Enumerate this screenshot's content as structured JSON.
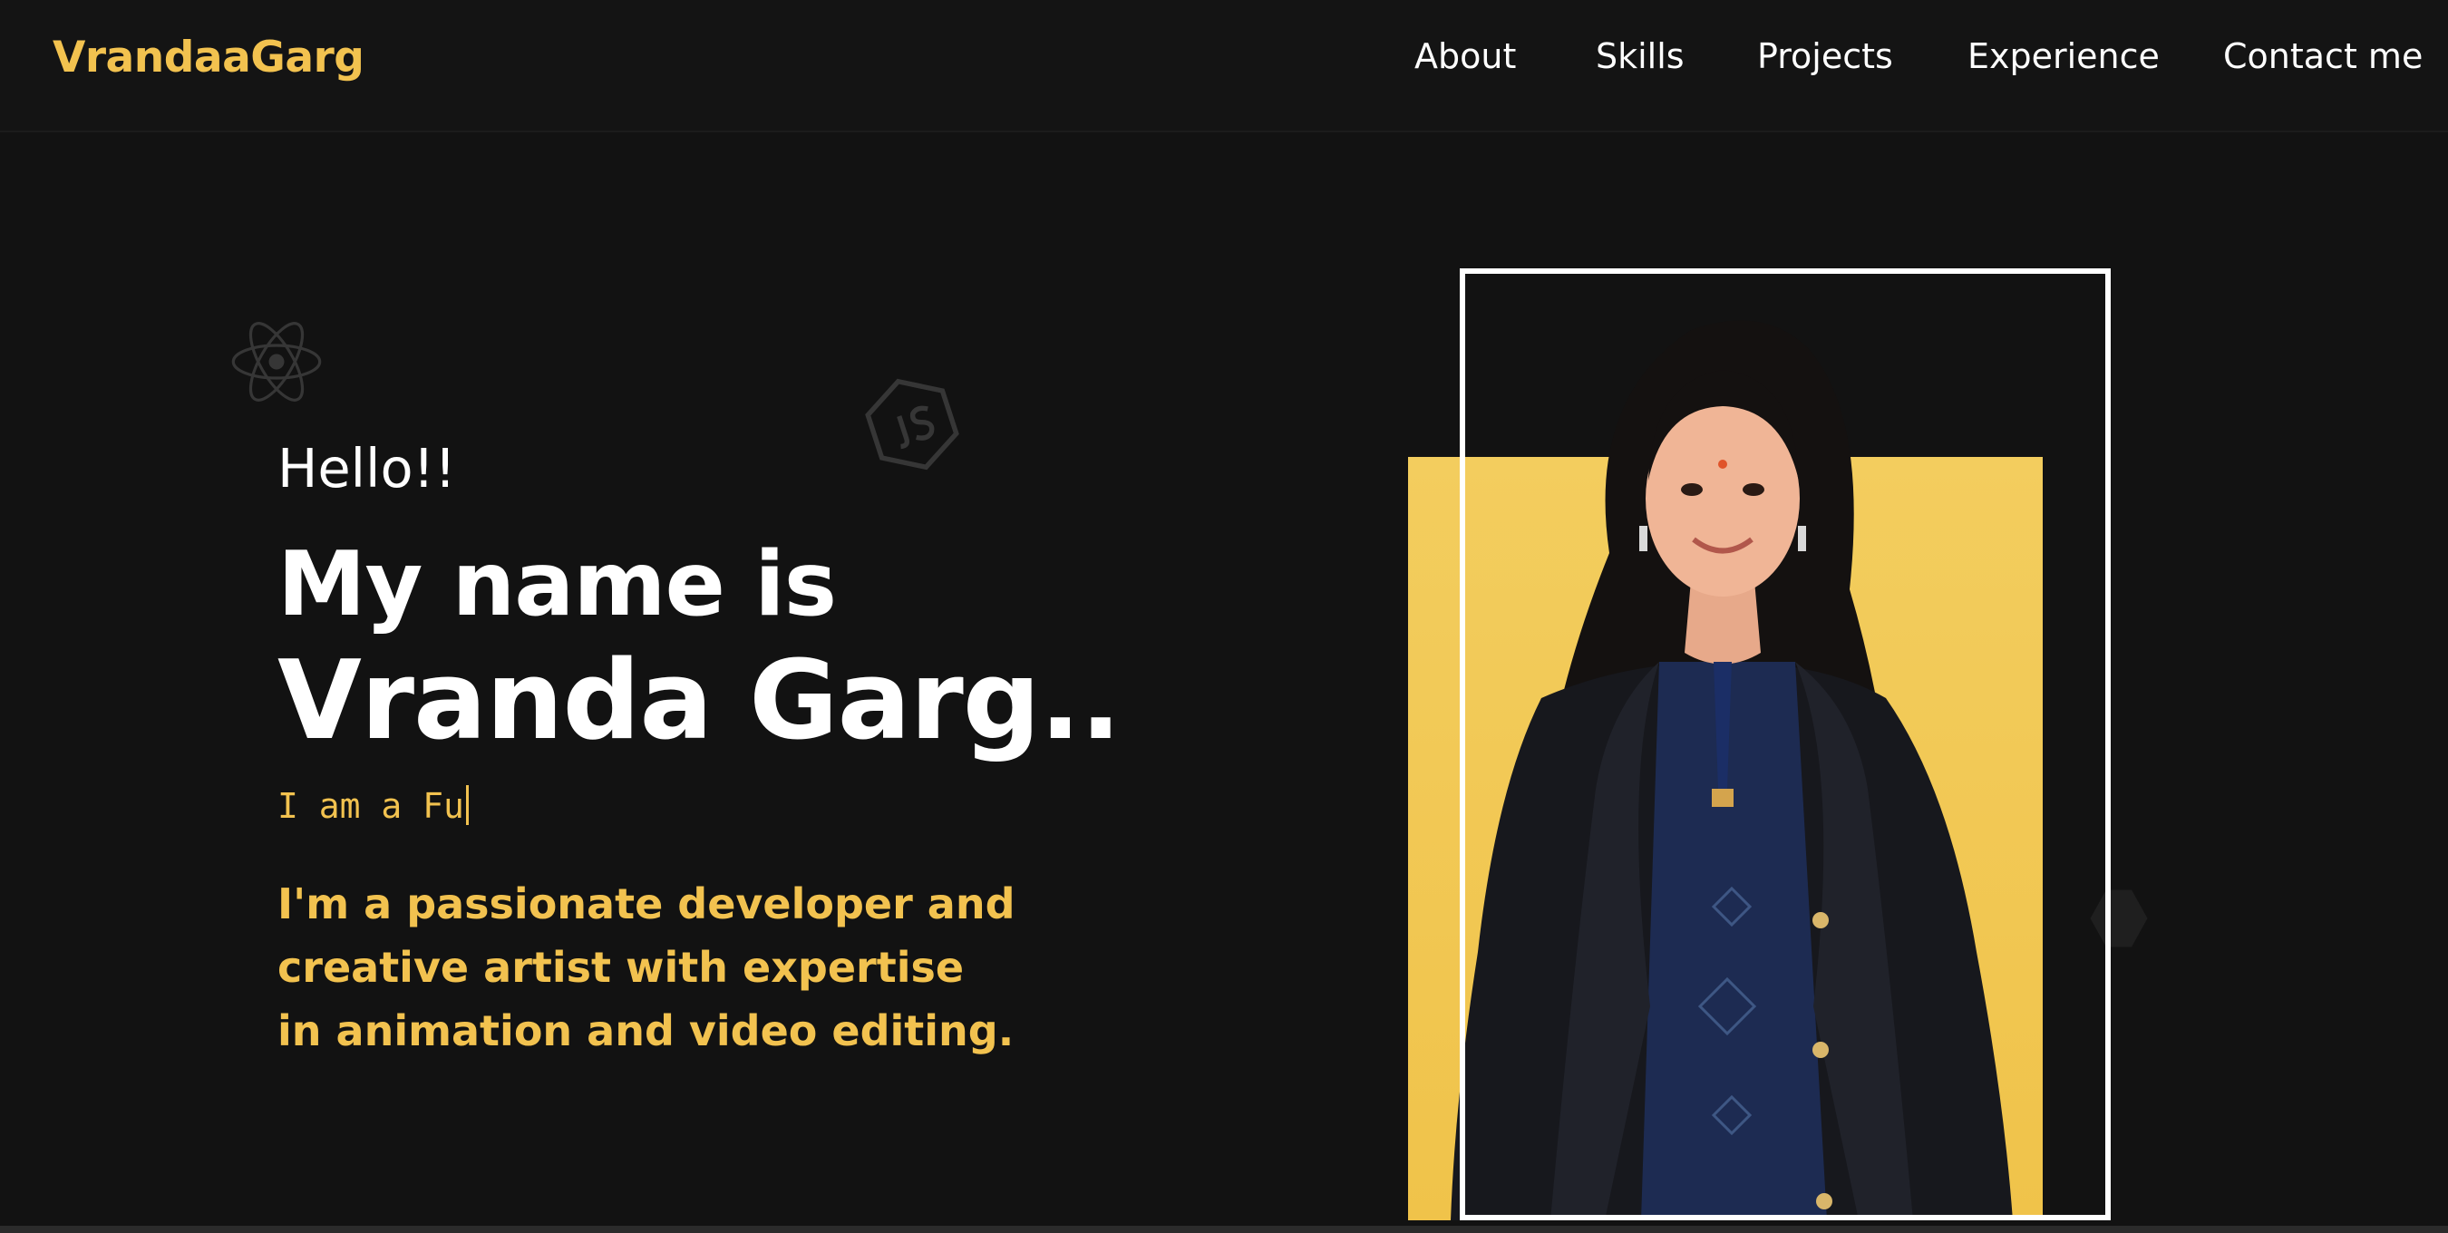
{
  "navbar": {
    "brand": "VrandaaGarg",
    "links": [
      {
        "label": "About"
      },
      {
        "label": "Skills"
      },
      {
        "label": "Projects"
      },
      {
        "label": "Experience"
      },
      {
        "label": "Contact me"
      }
    ]
  },
  "hero": {
    "greeting": "Hello!!",
    "name_line1": "My name is",
    "name_line2": "Vranda Garg..",
    "typing_text": "I am a Fu",
    "bio": "I'm a passionate developer and creative artist with expertise in animation and video editing."
  },
  "decorations": {
    "icons": [
      "react-icon",
      "js-hex-icon",
      "hexagon-icon"
    ]
  },
  "colors": {
    "background": "#121212",
    "accent": "#f2c24f",
    "text": "#ffffff"
  }
}
